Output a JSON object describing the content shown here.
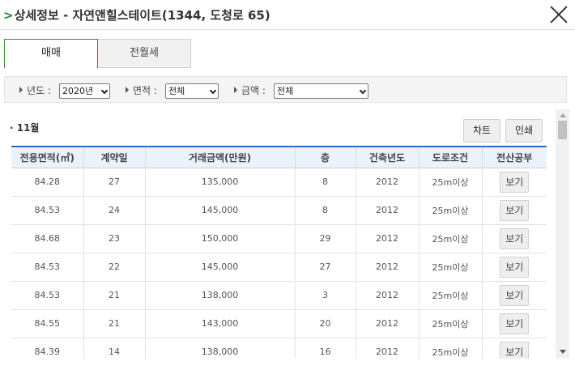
{
  "window": {
    "title": "상세정보 - 자연앤힐스테이트(1344, 도청로 65)",
    "chevron": ">"
  },
  "tabs": [
    {
      "label": "매매",
      "active": true
    },
    {
      "label": "전월세",
      "active": false
    }
  ],
  "filters": {
    "year": {
      "label": "년도 :",
      "value": "2020년"
    },
    "area": {
      "label": "면적 :",
      "value": "전체"
    },
    "amount": {
      "label": "금액 :",
      "value": "전체"
    }
  },
  "content": {
    "month": "· 11월",
    "chart_button": "차트",
    "print_button": "인쇄"
  },
  "table": {
    "headers": [
      "전용면적(㎡)",
      "계약일",
      "거래금액(만원)",
      "층",
      "건축년도",
      "도로조건",
      "전산공부"
    ],
    "rows": [
      [
        "84.28",
        "27",
        "135,000",
        "8",
        "2012",
        "25m이상",
        "보기"
      ],
      [
        "84.53",
        "24",
        "145,000",
        "8",
        "2012",
        "25m이상",
        "보기"
      ],
      [
        "84.68",
        "23",
        "150,000",
        "29",
        "2012",
        "25m이상",
        "보기"
      ],
      [
        "84.53",
        "22",
        "145,000",
        "27",
        "2012",
        "25m이상",
        "보기"
      ],
      [
        "84.53",
        "21",
        "138,000",
        "3",
        "2012",
        "25m이상",
        "보기"
      ],
      [
        "84.55",
        "21",
        "143,000",
        "20",
        "2012",
        "25m이상",
        "보기"
      ],
      [
        "84.39",
        "14",
        "138,000",
        "16",
        "2012",
        "25m이상",
        "보기"
      ]
    ]
  },
  "colors": {
    "accent_green": "#2e7d32",
    "header_border_blue": "#2c6fb0",
    "header_bg": "#eaf3fb"
  }
}
